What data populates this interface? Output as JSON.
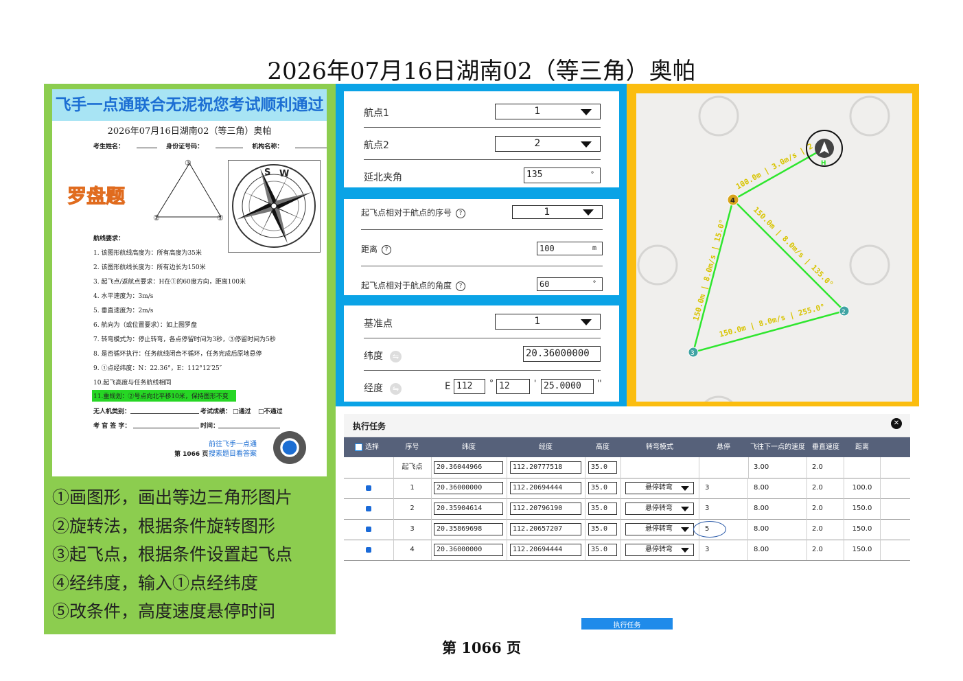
{
  "title": "2026年07月16日湖南02（等三角）奥帕",
  "page_footer": "第 1066 页",
  "paper": {
    "banner": "飞手一点通联合无泥祝您考试顺利通过",
    "subtitle": "2026年07月16日湖南02（等三角）奥帕",
    "fields": [
      "考生姓名：",
      "身份证号码：",
      "机构名称："
    ],
    "section_title": "罗盘题",
    "requirements_title": "航线要求：",
    "requirements": [
      "1. 该图形航线高度为：所有高度为35米",
      "2. 该图形航线长度为：所有边长为150米",
      "3. 起飞点/返航点要求：H在①的60度方向，距离100米",
      "4. 水平速度为：3m/s",
      "5. 垂直速度为：2m/s",
      "6. 航向为（或位置要求）：如上图罗盘",
      "7. 转弯模式为：停止转弯，各点停留时间为3秒，③停留时间为5秒",
      "8. 是否循环执行：任务航线闭合不循环，任务完成后原地悬停",
      "9. ①点经纬度：N：22.36°，E：112°12′25″",
      "10.起飞高度与任务航线相同",
      "11.重规划：②号点向北平移10米，保持图形不变"
    ],
    "uav_type": "无人机类别：",
    "result_label": "考试成绩：",
    "pass": "□通过",
    "fail": "□不通过",
    "examiner": "考 官 签 字：",
    "time_label": "时间：",
    "page_no": "第 1066 页",
    "promo_1": "前往飞手一点通",
    "promo_2": "搜索题目看答案",
    "triangle_labels": [
      "③",
      "②",
      "①"
    ],
    "compass_letters": [
      "S",
      "W"
    ]
  },
  "steps": [
    "①画图形，画出等边三角形图片",
    "②旋转法，根据条件旋转图形",
    "③起飞点，根据条件设置起飞点",
    "④经纬度，输入①点经纬度",
    "⑤改条件，高度速度悬停时间"
  ],
  "panel1": {
    "wp1_label": "航点1",
    "wp1_value": "1",
    "wp2_label": "航点2",
    "wp2_value": "2",
    "angle_label": "延北夹角",
    "angle_value": "135",
    "angle_unit": "°"
  },
  "panel2": {
    "seq_label": "起飞点相对于航点的序号",
    "seq_value": "1",
    "dist_label": "距离",
    "dist_value": "100",
    "dist_unit": "m",
    "ang_label": "起飞点相对于航点的角度",
    "ang_value": "60",
    "ang_unit": "°",
    "help": "?"
  },
  "panel3": {
    "base_label": "基准点",
    "base_value": "1",
    "lat_label": "纬度",
    "lat_value": "20.36000000",
    "lon_label": "经度",
    "lon_prefix": "E",
    "lon_deg": "112",
    "lon_min": "12",
    "lon_sec": "25.0000",
    "deg_sym": "°",
    "min_sym": "'",
    "sec_sym": "''",
    "swap": "⇋"
  },
  "map": {
    "edge_labels": [
      "100.0m | 3.0m/s | 2",
      "150.0m | 8.0m/s | 135.0°",
      "150.0m | 8.0m/s | 255.0°",
      "150.0m | 8.0m/s | 15.0°"
    ],
    "point_labels": [
      "4",
      "2",
      "3"
    ],
    "home_label": "H"
  },
  "mission": {
    "title": "执行任务",
    "close": "✕",
    "headers": [
      "选择",
      "序号",
      "纬度",
      "经度",
      "高度",
      "转弯模式",
      "悬停",
      "飞往下一点的速度",
      "垂直速度",
      "距离"
    ],
    "rows": [
      {
        "seq": "起飞点",
        "lat": "20.36044966",
        "lon": "112.20777518",
        "alt": "35.0",
        "mode": "",
        "hover": "",
        "speed": "3.00",
        "vspeed": "2.0",
        "dist": ""
      },
      {
        "seq": "1",
        "lat": "20.36000000",
        "lon": "112.20694444",
        "alt": "35.0",
        "mode": "悬停转弯",
        "hover": "3",
        "speed": "8.00",
        "vspeed": "2.0",
        "dist": "100.0"
      },
      {
        "seq": "2",
        "lat": "20.35904614",
        "lon": "112.20796190",
        "alt": "35.0",
        "mode": "悬停转弯",
        "hover": "3",
        "speed": "8.00",
        "vspeed": "2.0",
        "dist": "150.0"
      },
      {
        "seq": "3",
        "lat": "20.35869698",
        "lon": "112.20657207",
        "alt": "35.0",
        "mode": "悬停转弯",
        "hover": "5",
        "speed": "8.00",
        "vspeed": "2.0",
        "dist": "150.0"
      },
      {
        "seq": "4",
        "lat": "20.36000000",
        "lon": "112.20694444",
        "alt": "35.0",
        "mode": "悬停转弯",
        "hover": "3",
        "speed": "8.00",
        "vspeed": "2.0",
        "dist": "150.0"
      }
    ],
    "execute_button": "执行任务"
  },
  "colors": {
    "accent_blue": "#0aa3e6",
    "accent_orange": "#fbbd0f",
    "accent_green": "#8ccd4f",
    "route_green": "#2ee62e"
  }
}
